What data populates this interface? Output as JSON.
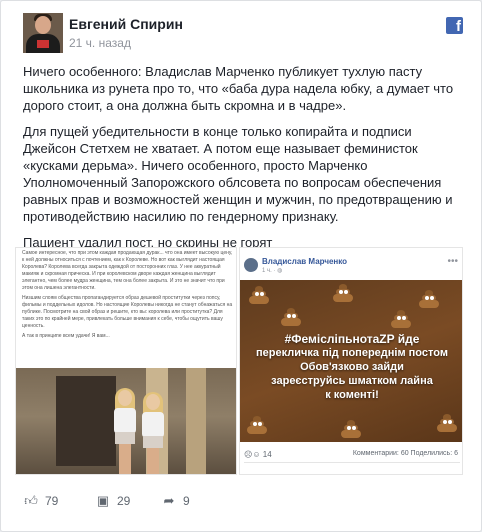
{
  "post": {
    "author": "Евгений Спирин",
    "time": "21 ч. назад",
    "paragraphs": [
      "Ничего особенного: Владислав Марченко публикует тухлую пасту школьника из рунета про то, что «баба дура надела юбку, а думает что дорого стоит, а она должна быть скромна и в чадре».",
      "Для пущей убедительности в конце только копирайта и подписи Джейсон Стетхем не хватает. А потом еще называет феминисток «кусками дерьма». Ничего особенного, просто Марченко Уполномоченный Запорожского облсовета по вопросам обеспечения равных прав и возможностей женщин и мужчин, по предотвращению и противодействию насилию по гендерному признаку.",
      "Пациент удалил пост, но скрины не горят"
    ]
  },
  "left_screenshot": {
    "paragraphs": [
      "Самое интересное, что при этом каждая продающая дурак... что она имеет высокую цену, к ней должны относиться с почтением, как к Королеве. Но вот как выглядит настоящая Королева? Королева всегда закрыта одеждой от посторонних глаз. У нее аккуратный макияж и скромная прическа. И при королевском дворе каждая женщина выглядит элегантно, чем более мудра женщина, тем она более закрыта. И это не значит что при этом она лишена элегантности.",
      "Низшим слоям общества пропагандируется образ дешевой проститутки через попсу, фильмы и поддельных идолов. Но настоящие Королевы никогда не станут обнажаться на публике. Посмотрите на свой образ и решите, кто вы: королева или проститутка? Для таких это по крайней мере, привлекать больше внимания к себе, чтобы ощутить вашу ценность.",
      "А так в принципе всем удачи! Я вам..."
    ]
  },
  "right_screenshot": {
    "name": "Владислав Марченко",
    "time": "1 ч. · ",
    "banner_lines": [
      "#ФемісліпьнотаZP йде",
      "перекличка під попереднім постом",
      "Обов'язково зайди",
      "зареєструйсь шматком лайна",
      "к коменті!"
    ],
    "reactions": "14",
    "comments": "Комментарии: 60  Поделились: 6"
  },
  "footer": {
    "likes": "79",
    "comments": "29",
    "shares": "9"
  },
  "icons": {
    "facebook": "facebook-icon",
    "like": "like-icon",
    "comment": "comment-icon",
    "share": "share-icon"
  },
  "colors": {
    "facebook_blue": "#4267b2",
    "text": "#1d2129",
    "muted": "#90949c"
  }
}
